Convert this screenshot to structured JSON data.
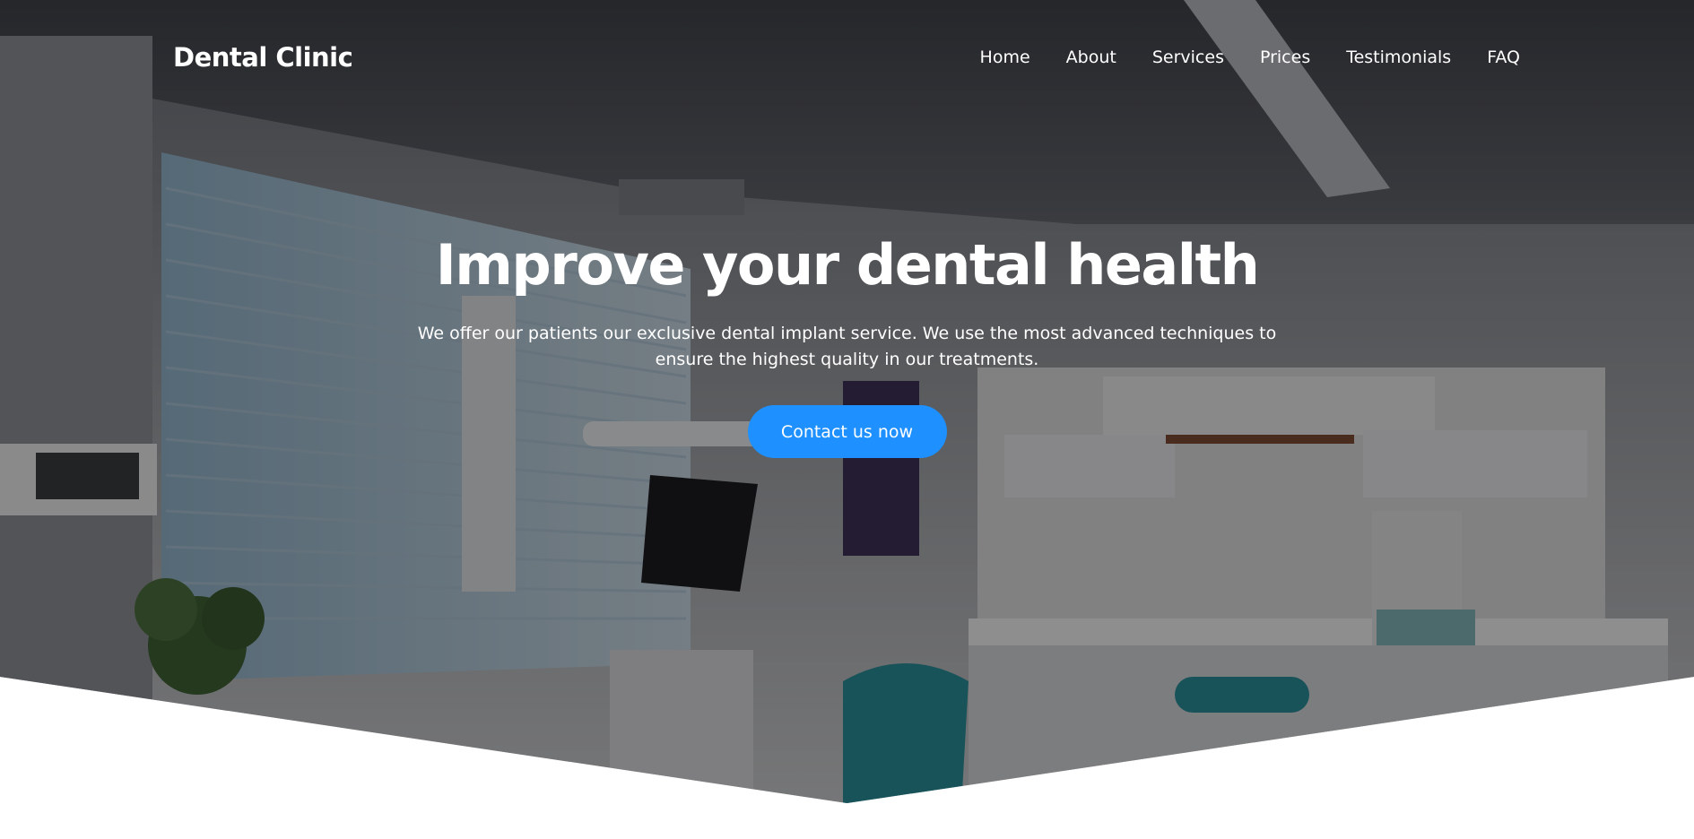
{
  "brand": {
    "name": "Dental Clinic"
  },
  "nav": {
    "items": [
      {
        "label": "Home"
      },
      {
        "label": "About"
      },
      {
        "label": "Services"
      },
      {
        "label": "Prices"
      },
      {
        "label": "Testimonials"
      },
      {
        "label": "FAQ"
      }
    ]
  },
  "hero": {
    "headline": "Improve your dental health",
    "subtext": "We offer our patients our exclusive dental implant service. We use the most advanced techniques to ensure the highest quality in our treatments.",
    "cta_label": "Contact us now",
    "background_description_icon": "dental-office-photo"
  },
  "colors": {
    "accent": "#1e90ff",
    "text_on_dark": "#ffffff",
    "page_background": "#ffffff"
  }
}
